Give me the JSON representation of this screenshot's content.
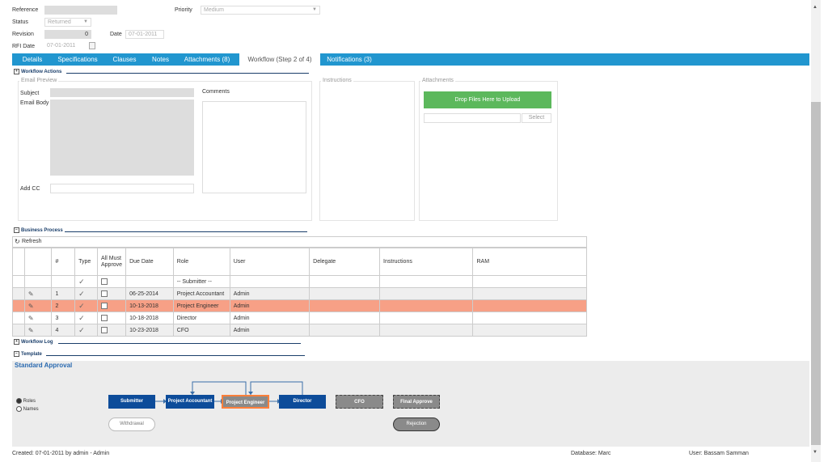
{
  "form": {
    "reference_label": "Reference",
    "priority_label": "Priority",
    "priority_value": "Medium",
    "status_label": "Status",
    "status_value": "Returned",
    "revision_label": "Revision",
    "revision_value": "0",
    "date_label": "Date",
    "date_value": "07-01-2011",
    "rfi_date_label": "RFI Date",
    "rfi_date_value": "07-01-2011"
  },
  "tabs": [
    {
      "label": "Details"
    },
    {
      "label": "Specifications"
    },
    {
      "label": "Clauses"
    },
    {
      "label": "Notes"
    },
    {
      "label": "Attachments (8)"
    },
    {
      "label": "Workflow (Step 2 of 4)",
      "active": true
    },
    {
      "label": "Notifications (3)"
    }
  ],
  "workflow_actions": {
    "header": "Workflow Actions",
    "email_preview_title": "Email Preview",
    "subject_label": "Subject",
    "email_body_label": "Email Body",
    "comments_label": "Comments",
    "add_cc_label": "Add CC",
    "instructions_title": "Instructions",
    "attachments_title": "Attachments",
    "drop_files_label": "Drop Files Here to Upload",
    "select_button": "Select"
  },
  "business_process": {
    "header": "Business Process",
    "refresh_label": "Refresh",
    "columns": {
      "num": "#",
      "type": "Type",
      "all_must_approve": "All Must Approve",
      "due_date": "Due Date",
      "role": "Role",
      "user": "User",
      "delegate": "Delegate",
      "instructions": "Instructions",
      "ram": "RAM"
    },
    "rows": [
      {
        "num": "",
        "due": "",
        "role": "-- Submitter --",
        "user": ""
      },
      {
        "num": "1",
        "due": "06-25-2014",
        "role": "Project Accountant",
        "user": "Admin"
      },
      {
        "num": "2",
        "due": "10-13-2018",
        "role": "Project Engineer",
        "user": "Admin"
      },
      {
        "num": "3",
        "due": "10-18-2018",
        "role": "Director",
        "user": "Admin"
      },
      {
        "num": "4",
        "due": "10-23-2018",
        "role": "CFO",
        "user": "Admin"
      }
    ]
  },
  "workflow_log": {
    "header": "Workflow Log"
  },
  "template": {
    "header": "Template",
    "name": "Standard Approval",
    "radio_roles": "Roles",
    "radio_names": "Names",
    "nodes": {
      "submitter": "Submitter",
      "project_accountant": "Project Accountant",
      "project_engineer": "Project Engineer",
      "director": "Director",
      "cfo": "CFO",
      "final_approve": "Final Approve",
      "withdrawal": "Withdrawal",
      "rejection": "Rejection"
    }
  },
  "footer": {
    "created": "Created:  07-01-2011 by admin - Admin",
    "database": "Database:  Marc",
    "user": "User:  Bassam Samman"
  },
  "colors": {
    "tab_bar": "#2196cf",
    "upload_green": "#5cb85c",
    "node_blue": "#0d4c9a",
    "selected_row": "#f7a086",
    "highlight_orange": "#ff7f3a"
  }
}
